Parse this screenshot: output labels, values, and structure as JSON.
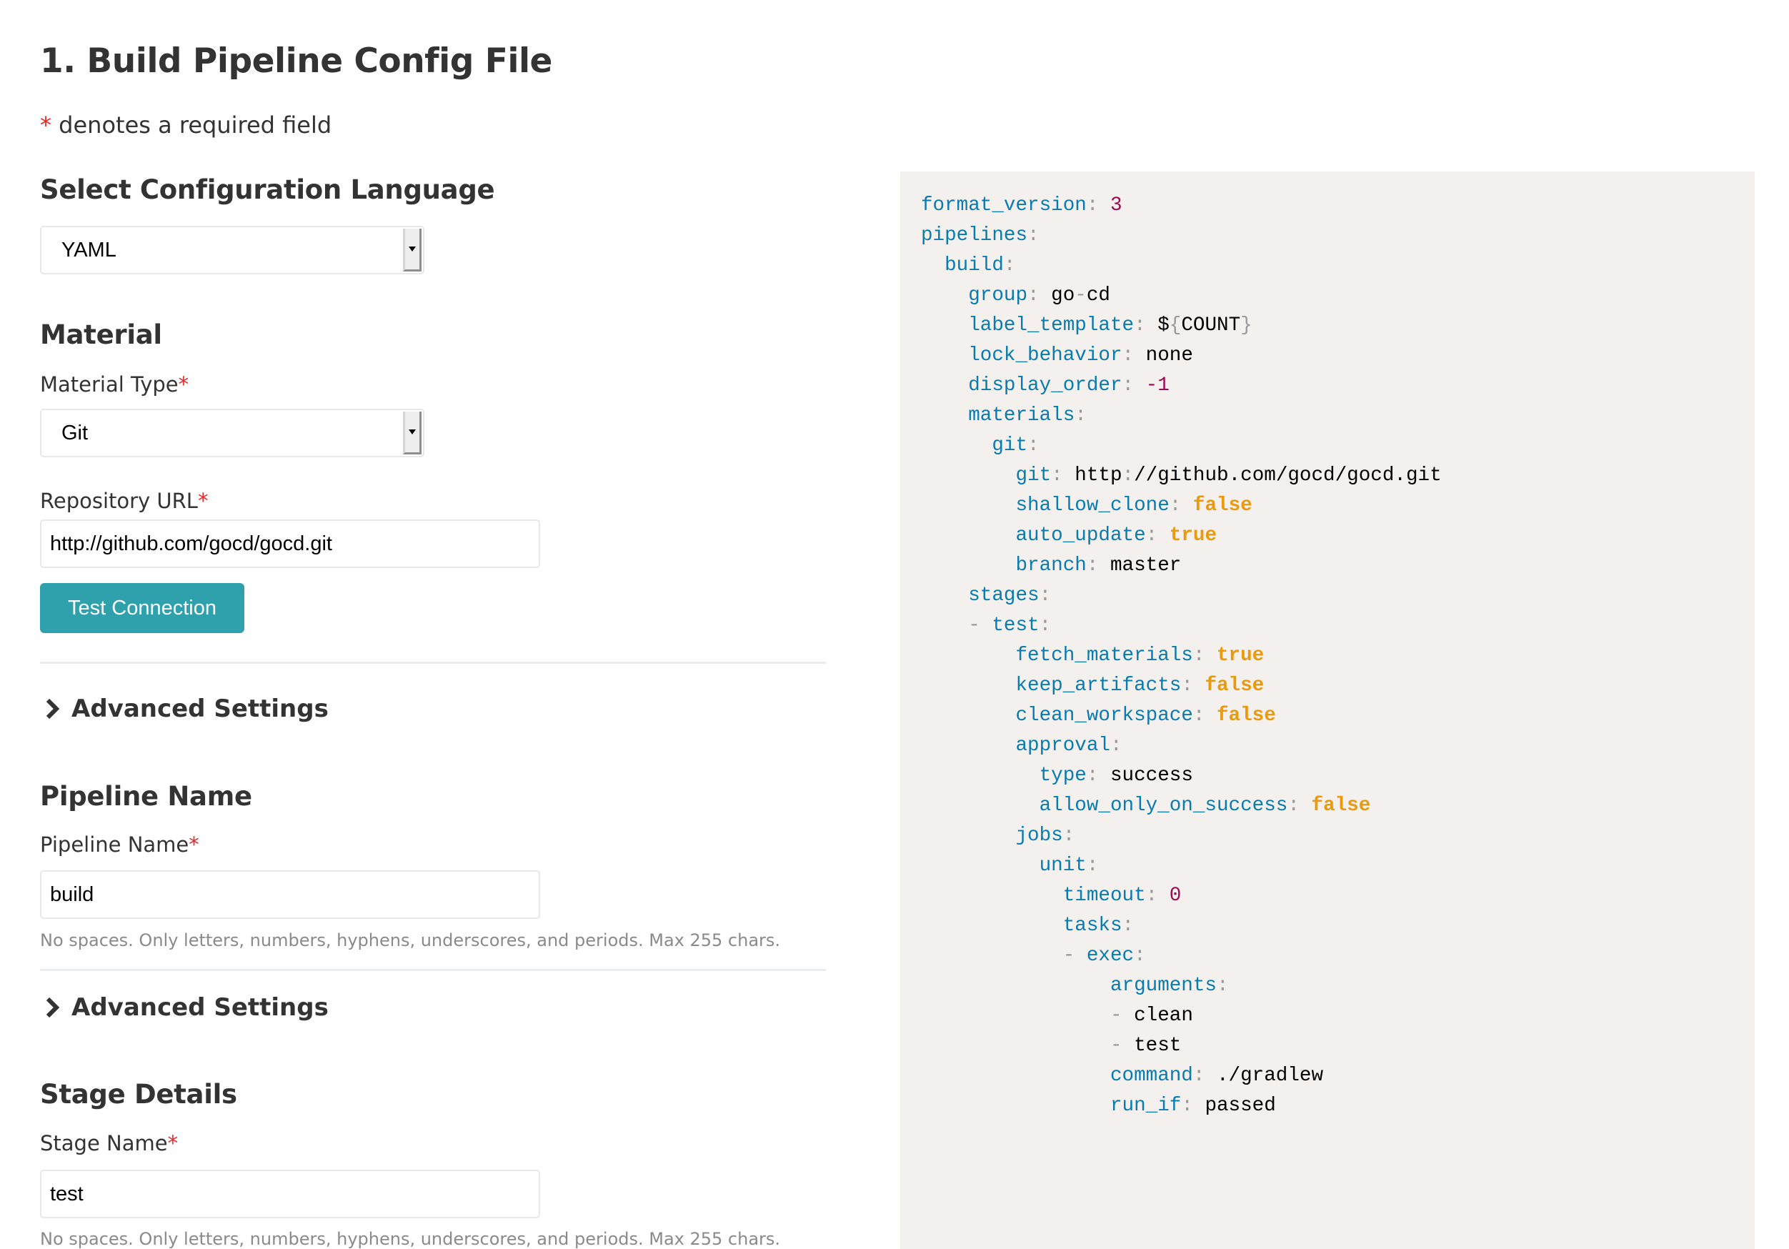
{
  "page": {
    "title": "1. Build Pipeline Config File",
    "required_note_star": "*",
    "required_note_text": " denotes a required field"
  },
  "config_language": {
    "heading": "Select Configuration Language",
    "selected": "YAML"
  },
  "material": {
    "heading": "Material",
    "type_label": "Material Type",
    "type_selected": "Git",
    "repo_label": "Repository URL",
    "repo_value": "http://github.com/gocd/gocd.git",
    "test_button": "Test Connection",
    "advanced_label": "Advanced Settings"
  },
  "pipeline": {
    "heading": "Pipeline Name",
    "name_label": "Pipeline Name",
    "name_value": "build",
    "hint": "No spaces. Only letters, numbers, hyphens, underscores, and periods. Max 255 chars.",
    "advanced_label": "Advanced Settings"
  },
  "stage": {
    "heading": "Stage Details",
    "name_label": "Stage Name",
    "name_value": "test",
    "hint": "No spaces. Only letters, numbers, hyphens, underscores, and periods. Max 255 chars."
  },
  "required_star": "*",
  "colors": {
    "accent_button": "#2fa1ad",
    "required_star": "#e8292a",
    "code_background": "#f4f0ed",
    "yaml_key": "#0a7bae",
    "yaml_number": "#9b0b53",
    "yaml_boolean": "#e99a0d",
    "yaml_punctuation": "#999999"
  },
  "yaml_preview": [
    {
      "indent": 0,
      "dash": false,
      "key": "format_version",
      "value": "3",
      "type": "number"
    },
    {
      "indent": 0,
      "dash": false,
      "key": "pipelines",
      "value": null,
      "type": null
    },
    {
      "indent": 1,
      "dash": false,
      "key": "build",
      "value": null,
      "type": null
    },
    {
      "indent": 2,
      "dash": false,
      "key": "group",
      "value": "go-cd",
      "type": "string"
    },
    {
      "indent": 2,
      "dash": false,
      "key": "label_template",
      "value": "${COUNT}",
      "type": "string"
    },
    {
      "indent": 2,
      "dash": false,
      "key": "lock_behavior",
      "value": "none",
      "type": "string"
    },
    {
      "indent": 2,
      "dash": false,
      "key": "display_order",
      "value": "-1",
      "type": "number"
    },
    {
      "indent": 2,
      "dash": false,
      "key": "materials",
      "value": null,
      "type": null
    },
    {
      "indent": 3,
      "dash": false,
      "key": "git",
      "value": null,
      "type": null
    },
    {
      "indent": 4,
      "dash": false,
      "key": "git",
      "value": "http://github.com/gocd/gocd.git",
      "type": "string"
    },
    {
      "indent": 4,
      "dash": false,
      "key": "shallow_clone",
      "value": "false",
      "type": "boolean"
    },
    {
      "indent": 4,
      "dash": false,
      "key": "auto_update",
      "value": "true",
      "type": "boolean"
    },
    {
      "indent": 4,
      "dash": false,
      "key": "branch",
      "value": "master",
      "type": "string"
    },
    {
      "indent": 2,
      "dash": false,
      "key": "stages",
      "value": null,
      "type": null
    },
    {
      "indent": 2,
      "dash": true,
      "key": "test",
      "value": null,
      "type": null
    },
    {
      "indent": 4,
      "dash": false,
      "key": "fetch_materials",
      "value": "true",
      "type": "boolean"
    },
    {
      "indent": 4,
      "dash": false,
      "key": "keep_artifacts",
      "value": "false",
      "type": "boolean"
    },
    {
      "indent": 4,
      "dash": false,
      "key": "clean_workspace",
      "value": "false",
      "type": "boolean"
    },
    {
      "indent": 4,
      "dash": false,
      "key": "approval",
      "value": null,
      "type": null
    },
    {
      "indent": 5,
      "dash": false,
      "key": "type",
      "value": "success",
      "type": "string"
    },
    {
      "indent": 5,
      "dash": false,
      "key": "allow_only_on_success",
      "value": "false",
      "type": "boolean"
    },
    {
      "indent": 4,
      "dash": false,
      "key": "jobs",
      "value": null,
      "type": null
    },
    {
      "indent": 5,
      "dash": false,
      "key": "unit",
      "value": null,
      "type": null
    },
    {
      "indent": 6,
      "dash": false,
      "key": "timeout",
      "value": "0",
      "type": "number"
    },
    {
      "indent": 6,
      "dash": false,
      "key": "tasks",
      "value": null,
      "type": null
    },
    {
      "indent": 6,
      "dash": true,
      "key": "exec",
      "value": null,
      "type": null
    },
    {
      "indent": 8,
      "dash": false,
      "key": "arguments",
      "value": null,
      "type": null
    },
    {
      "indent": 8,
      "dash": true,
      "key": null,
      "value": "clean",
      "type": "string"
    },
    {
      "indent": 8,
      "dash": true,
      "key": null,
      "value": "test",
      "type": "string"
    },
    {
      "indent": 8,
      "dash": false,
      "key": "command",
      "value": "./gradlew",
      "type": "string"
    },
    {
      "indent": 8,
      "dash": false,
      "key": "run_if",
      "value": "passed",
      "type": "string"
    }
  ]
}
